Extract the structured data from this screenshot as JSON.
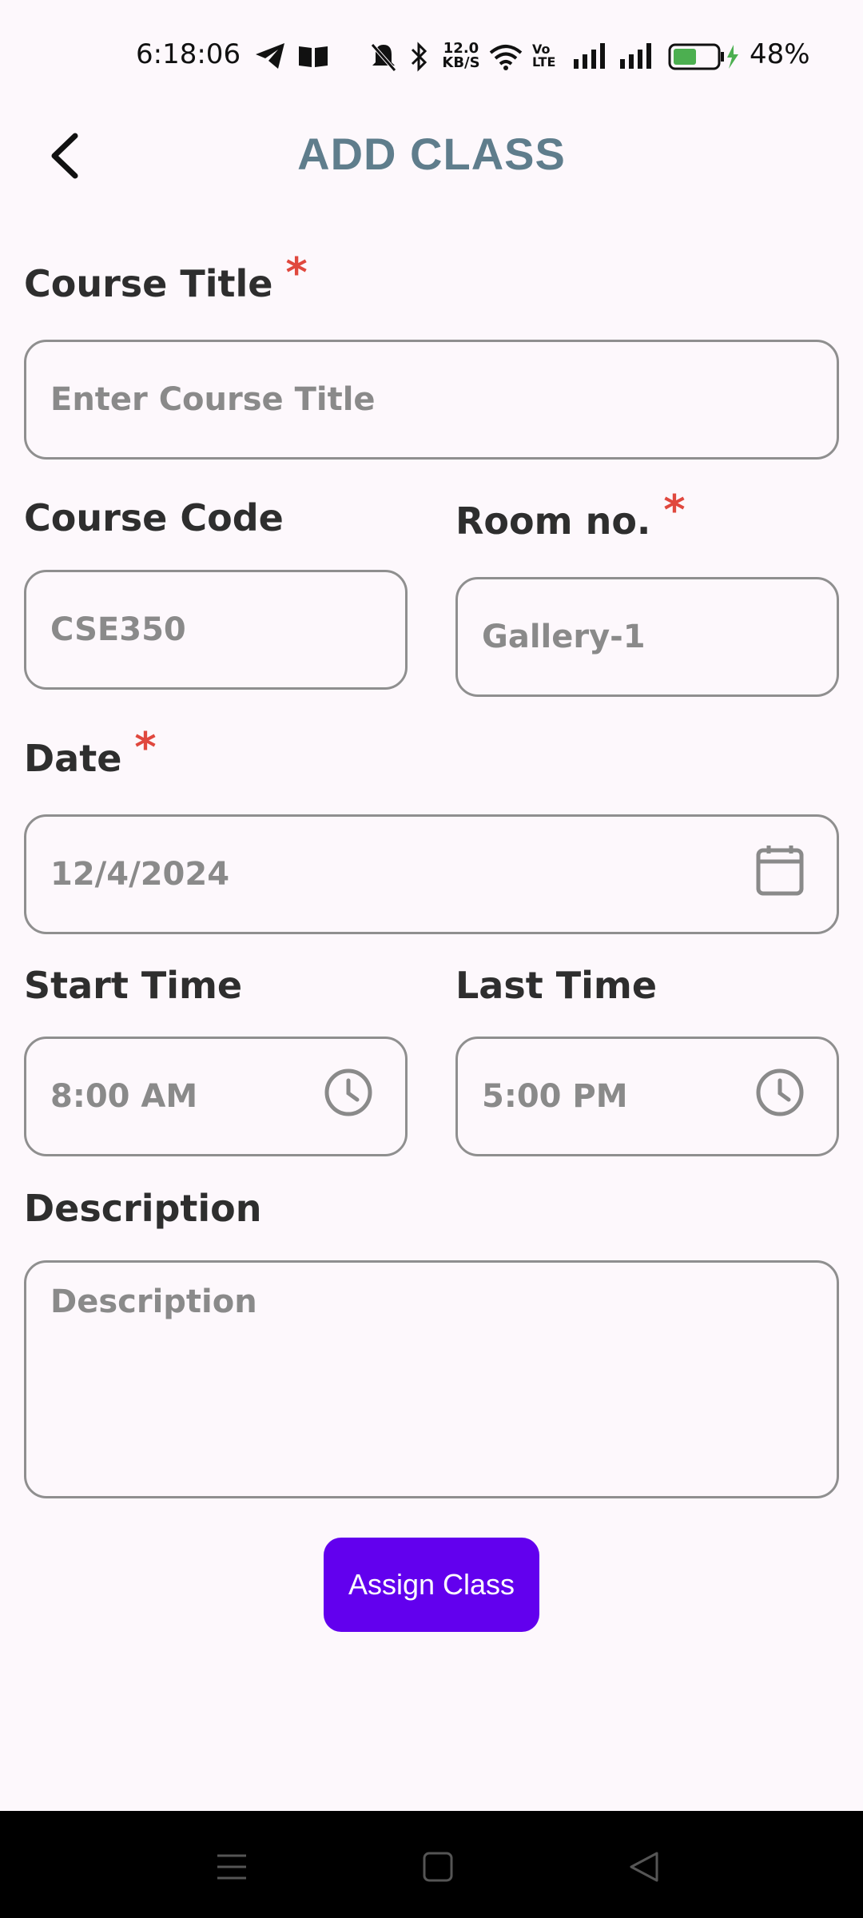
{
  "status_bar": {
    "time": "6:18:06",
    "network_speed": "12.0\nKB/S",
    "battery": "48%"
  },
  "header": {
    "title": "ADD CLASS"
  },
  "form": {
    "course_title": {
      "label": "Course Title",
      "required": "*",
      "placeholder": "Enter Course Title"
    },
    "course_code": {
      "label": "Course Code",
      "placeholder": "CSE350"
    },
    "room_no": {
      "label": "Room no.",
      "required": "*",
      "placeholder": "Gallery-1"
    },
    "date": {
      "label": "Date",
      "required": "*",
      "value": "12/4/2024"
    },
    "start_time": {
      "label": "Start Time",
      "value": "8:00 AM"
    },
    "last_time": {
      "label": "Last Time",
      "value": "5:00 PM"
    },
    "description": {
      "label": "Description",
      "placeholder": "Description"
    }
  },
  "actions": {
    "assign_label": "Assign Class",
    "accent": "#6200ee"
  },
  "colors": {
    "title": "#5f7d8c",
    "required": "#e0483e",
    "background": "#fdf8fc"
  }
}
